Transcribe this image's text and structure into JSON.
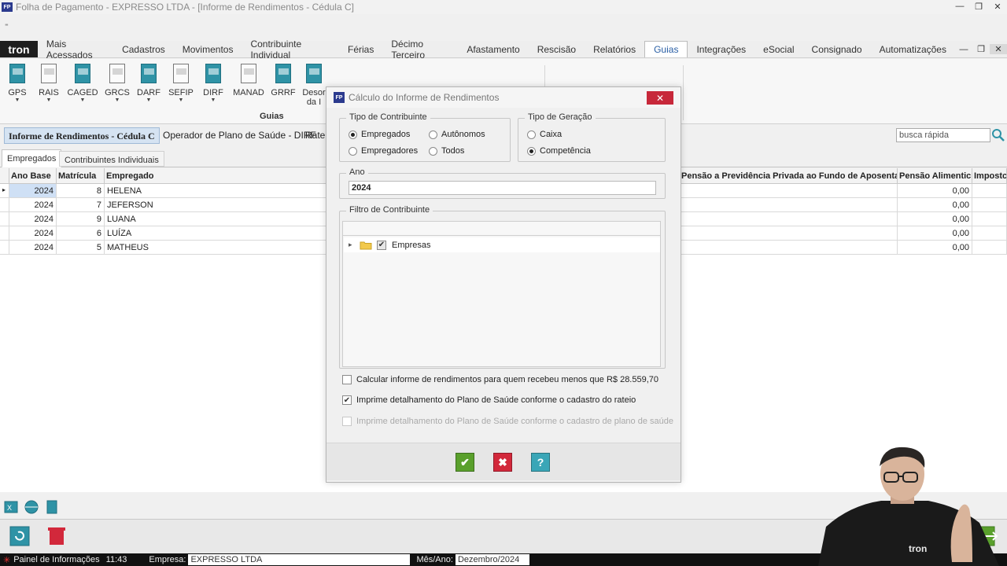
{
  "window": {
    "app_icon": "FP",
    "title": "Folha de Pagamento - EXPRESSO LTDA - [Informe de Rendimentos - Cédula C]",
    "controls": [
      "minimize-icon",
      "restore-icon",
      "close-icon"
    ]
  },
  "quick_access": {
    "marker": "⁼"
  },
  "menu": {
    "logo": "tron",
    "items": [
      "Mais Acessados",
      "Cadastros",
      "Movimentos",
      "Contribuinte Individual",
      "Férias",
      "Décimo Terceiro",
      "Afastamento",
      "Rescisão",
      "Relatórios",
      "Guias",
      "Integrações",
      "eSocial",
      "Consignado",
      "Automatizações"
    ],
    "active": "Guias"
  },
  "ribbon": {
    "buttons": [
      {
        "label": "GPS",
        "icon": "document-teal-icon"
      },
      {
        "label": "RAIS",
        "icon": "document-white-icon"
      },
      {
        "label": "CAGED",
        "icon": "document-teal-icon"
      },
      {
        "label": "GRCS",
        "icon": "document-white-icon"
      },
      {
        "label": "DARF",
        "icon": "document-teal-icon"
      },
      {
        "label": "SEFIP",
        "icon": "document-white-icon"
      },
      {
        "label": "DIRF",
        "icon": "document-teal-icon"
      },
      {
        "label": "MANAD",
        "icon": "document-white-icon"
      },
      {
        "label": "GRRF",
        "icon": "document-teal-icon"
      },
      {
        "label": "Desor da I",
        "icon": "document-teal-icon"
      }
    ],
    "group_label": "Guias"
  },
  "doc_tabs": {
    "active": "Informe de Rendimentos - Cédula C",
    "second": "Operador de Plano de Saúde - DIRF",
    "third": "Ratei"
  },
  "search": {
    "placeholder": "busca rápida"
  },
  "sub_tabs": [
    "Empregados",
    "Contribuintes Individuais"
  ],
  "grid": {
    "columns": [
      "Ano Base",
      "Matrícula",
      "Empregado",
      "Pensão a Previdência Privada ao Fundo de Aposenta",
      "Pensão Alimentic",
      "Impostc"
    ],
    "rows": [
      {
        "ano": "2024",
        "matricula": "8",
        "empregado": "HELENA",
        "pensao": "0,00"
      },
      {
        "ano": "2024",
        "matricula": "7",
        "empregado": "JEFERSON",
        "pensao": "0,00"
      },
      {
        "ano": "2024",
        "matricula": "9",
        "empregado": "LUANA",
        "pensao": "0,00"
      },
      {
        "ano": "2024",
        "matricula": "6",
        "empregado": "LUÍZA",
        "pensao": "0,00"
      },
      {
        "ano": "2024",
        "matricula": "5",
        "empregado": "MATHEUS",
        "pensao": "0,00"
      }
    ]
  },
  "dialog": {
    "icon": "FP",
    "title": "Cálculo do Informe de Rendimentos",
    "tipo_contribuinte": {
      "legend": "Tipo de Contribuinte",
      "options": [
        "Empregados",
        "Autônomos",
        "Empregadores",
        "Todos"
      ],
      "selected": "Empregados"
    },
    "tipo_geracao": {
      "legend": "Tipo de Geração",
      "options": [
        "Caixa",
        "Competência"
      ],
      "selected": "Competência"
    },
    "ano": {
      "legend": "Ano",
      "value": "2024"
    },
    "filtro": {
      "legend": "Filtro de Contribuinte",
      "node": "Empresas",
      "expand_glyph": "▸",
      "check_glyph": "✔"
    },
    "options": [
      {
        "label": "Calcular informe de rendimentos para quem recebeu menos que R$ 28.559,70",
        "checked": false,
        "enabled": true
      },
      {
        "label": "Imprime detalhamento do Plano de Saúde conforme o cadastro do rateio",
        "checked": true,
        "enabled": true
      },
      {
        "label": "Imprime detalhamento do Plano de Saúde conforme o cadastro de plano de saúde",
        "checked": false,
        "enabled": false
      }
    ],
    "buttons": {
      "ok": "✔",
      "cancel": "✖",
      "help": "?"
    },
    "close": "✕"
  },
  "statusbar": {
    "panel": "Painel de Informações",
    "time": "11:43",
    "empresa_label": "Empresa:",
    "empresa_value": "EXPRESSO LTDA",
    "mes_label": "Mês/Ano:",
    "mes_value": "Dezembro/2024"
  },
  "colors": {
    "accent_teal": "#2f93a6",
    "close_red": "#c7283a",
    "ok_green": "#5aa02c",
    "cancel_red": "#d2283b",
    "help_teal": "#3aa6b7",
    "selection": "#cfe0f5"
  }
}
